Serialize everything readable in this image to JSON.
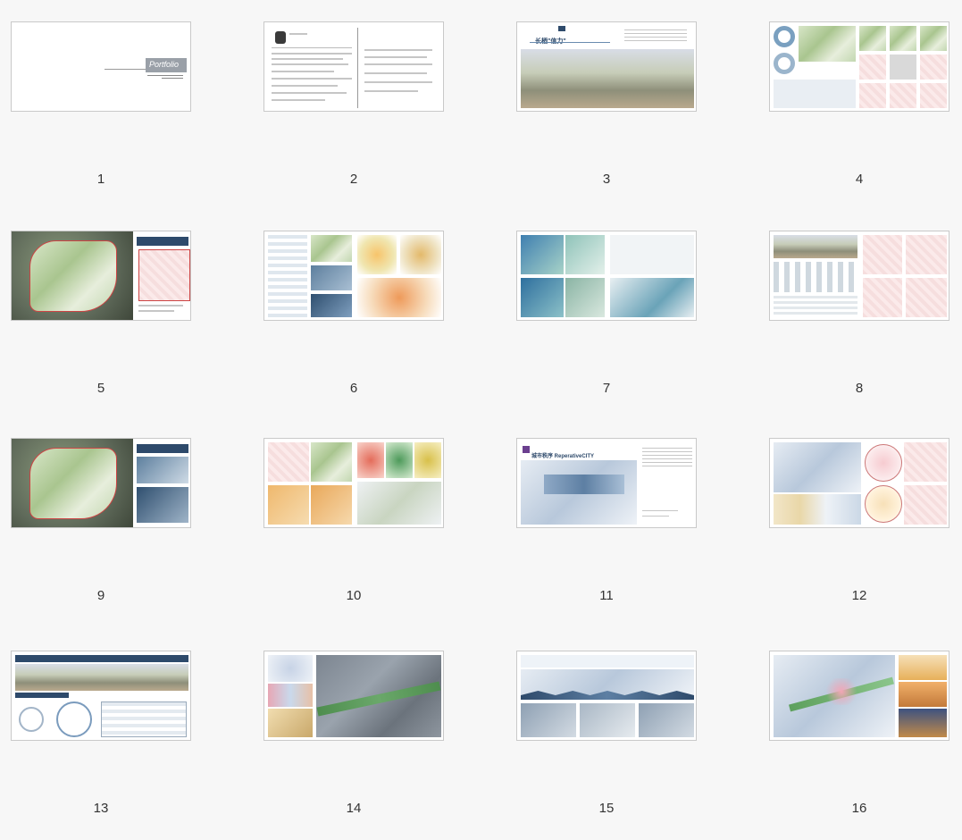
{
  "thumbnails": [
    {
      "number": "1"
    },
    {
      "number": "2"
    },
    {
      "number": "3"
    },
    {
      "number": "4"
    },
    {
      "number": "5"
    },
    {
      "number": "6"
    },
    {
      "number": "7"
    },
    {
      "number": "8"
    },
    {
      "number": "9"
    },
    {
      "number": "10"
    },
    {
      "number": "11"
    },
    {
      "number": "12"
    },
    {
      "number": "13"
    },
    {
      "number": "14"
    },
    {
      "number": "15"
    },
    {
      "number": "16"
    }
  ],
  "page1": {
    "title": "Portfolio"
  },
  "page3": {
    "title": "长栖\"信力\""
  },
  "page11": {
    "title": "城市秩序 ReperativeCITY"
  },
  "colors": {
    "background": "#f7f7f7",
    "page_border": "#c9c9c9",
    "label": "#333333",
    "accent_navy": "#2e4a6b",
    "accent_green": "#8fb07a",
    "accent_pink": "#e8a9a9"
  }
}
